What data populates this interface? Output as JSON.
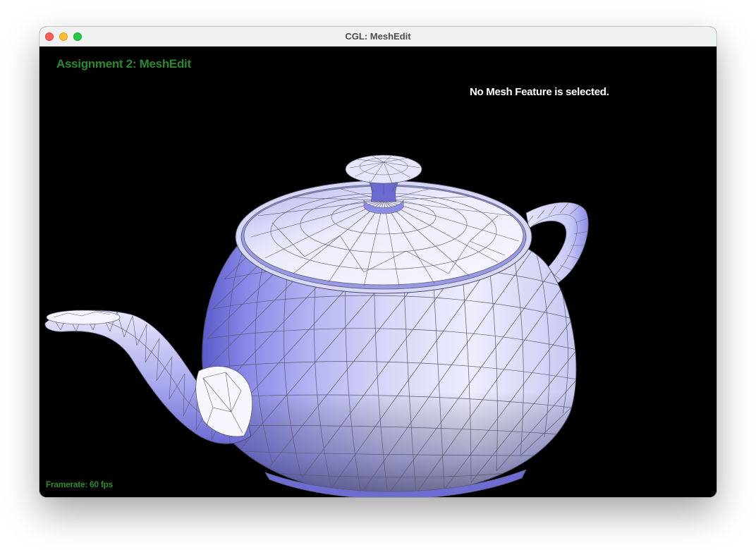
{
  "window": {
    "title": "CGL: MeshEdit",
    "buttons": [
      "close",
      "minimize",
      "zoom"
    ]
  },
  "hud": {
    "title": "Assignment 2: MeshEdit",
    "status": "No Mesh Feature is selected.",
    "framerate": "Framerate: 60 fps"
  },
  "scene": {
    "background": "#000000",
    "model": "teapot-mesh",
    "shade_light": "#f2f2ff",
    "shade_mid": "#b3b3f0",
    "shade_dark": "#7070d8",
    "wire_color": "#5a5a70",
    "hud_color": "#2b8a2b"
  }
}
